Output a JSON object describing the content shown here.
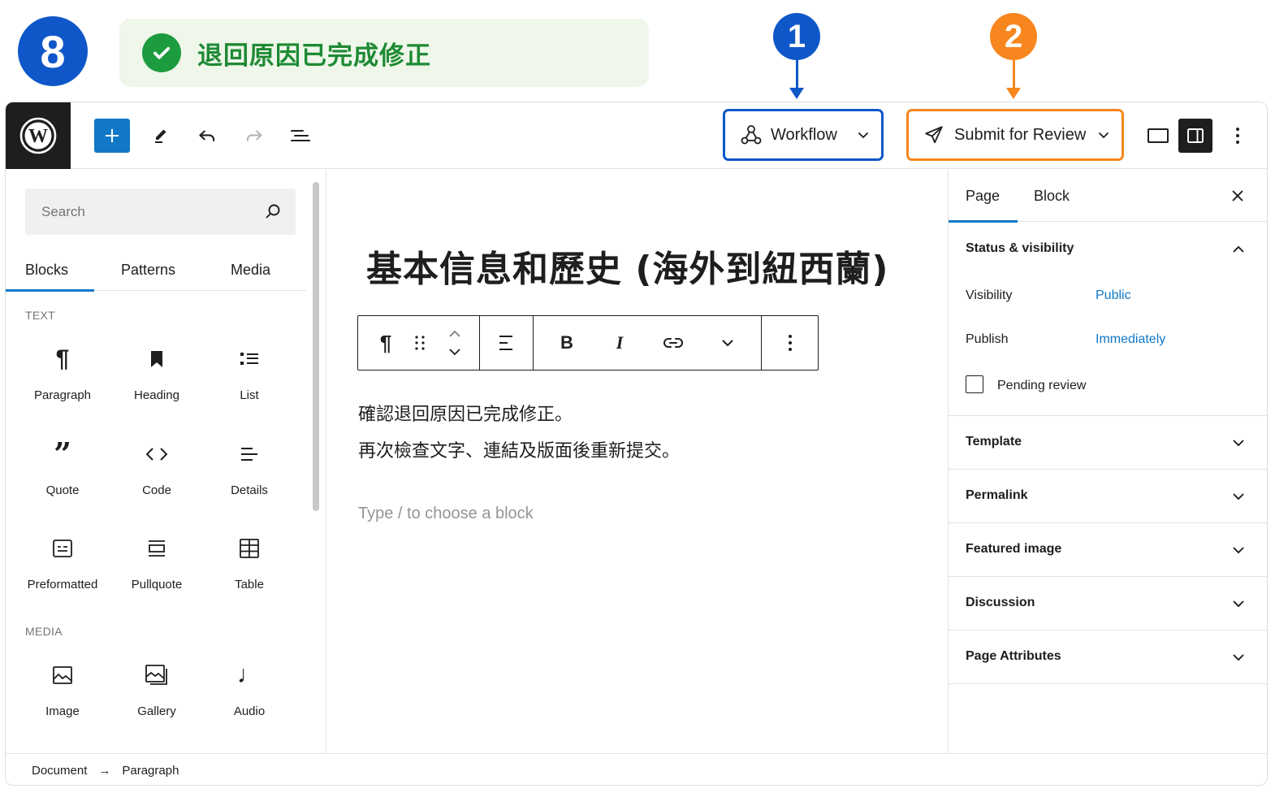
{
  "annotation": {
    "step_number": "8",
    "notice_text": "退回原因已完成修正",
    "callout_1": "1",
    "callout_2": "2",
    "colors": {
      "step_blue": "#0f57c9",
      "callout_orange": "#f7861e",
      "notice_green": "#1f8a34",
      "notice_bg": "#eef7e9"
    }
  },
  "toolbar": {
    "logo_icon": "wordpress-icon",
    "inserter_icon": "plus-icon",
    "tools_icon": "pencil-icon",
    "undo_icon": "undo-icon",
    "redo_icon": "redo-icon",
    "document_overview_icon": "list-view-icon",
    "workflow_label": "Workflow",
    "submit_label": "Submit for Review",
    "view_icon": "desktop-view-icon",
    "settings_icon": "sidebar-toggle-icon",
    "more_icon": "more-vertical-icon"
  },
  "inserter": {
    "search_placeholder": "Search",
    "tabs": [
      "Blocks",
      "Patterns",
      "Media"
    ],
    "text_section": "TEXT",
    "media_section": "MEDIA",
    "text_blocks": [
      {
        "label": "Paragraph",
        "icon": "paragraph-icon"
      },
      {
        "label": "Heading",
        "icon": "heading-bookmark-icon"
      },
      {
        "label": "List",
        "icon": "list-icon"
      },
      {
        "label": "Quote",
        "icon": "quote-icon"
      },
      {
        "label": "Code",
        "icon": "code-icon"
      },
      {
        "label": "Details",
        "icon": "details-icon"
      },
      {
        "label": "Preformatted",
        "icon": "preformatted-icon"
      },
      {
        "label": "Pullquote",
        "icon": "pullquote-icon"
      },
      {
        "label": "Table",
        "icon": "table-icon"
      }
    ],
    "media_blocks": [
      {
        "label": "Image",
        "icon": "image-icon"
      },
      {
        "label": "Gallery",
        "icon": "gallery-icon"
      },
      {
        "label": "Audio",
        "icon": "audio-icon"
      }
    ]
  },
  "canvas": {
    "post_title": "基本信息和歷史 (海外到紐西蘭)",
    "paragraph_1": "確認退回原因已完成修正。",
    "paragraph_2": "再次檢查文字、連結及版面後重新提交。",
    "placeholder": "Type / to choose a block",
    "block_toolbar": {
      "bold": "B",
      "italic": "I"
    }
  },
  "settings": {
    "tabs": [
      "Page",
      "Block"
    ],
    "status_title": "Status & visibility",
    "visibility_label": "Visibility",
    "visibility_value": "Public",
    "publish_label": "Publish",
    "publish_value": "Immediately",
    "pending_label": "Pending review",
    "pending_checked": false,
    "sections": [
      "Template",
      "Permalink",
      "Featured image",
      "Discussion",
      "Page Attributes"
    ]
  },
  "breadcrumb": {
    "items": [
      "Document",
      "Paragraph"
    ],
    "separator": "→"
  }
}
